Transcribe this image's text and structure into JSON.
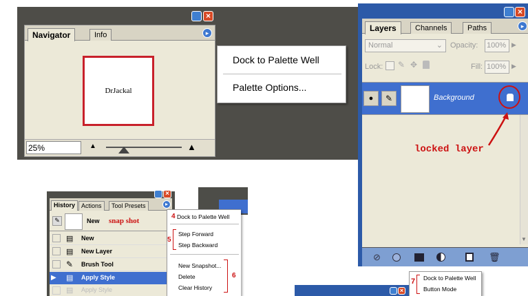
{
  "navigator": {
    "tabs": [
      "Navigator",
      "Info"
    ],
    "preview_text": "DrJackal",
    "zoom": "25%",
    "menu": [
      "Dock to Palette Well",
      "Palette Options..."
    ]
  },
  "layers": {
    "tabs": [
      "Layers",
      "Channels",
      "Paths"
    ],
    "blend_mode": "Normal",
    "opacity_label": "Opacity:",
    "opacity_value": "100%",
    "lock_label": "Lock:",
    "fill_label": "Fill:",
    "fill_value": "100%",
    "layer_name": "Background",
    "annotation": "locked layer"
  },
  "history": {
    "tabs": [
      "History",
      "Actions",
      "Tool Presets"
    ],
    "snapshot_name": "New",
    "snapshot_annotation": "snap shot",
    "items": [
      "New",
      "New Layer",
      "Brush Tool",
      "Apply Style",
      "Apply Style"
    ],
    "menu": {
      "dock": "Dock to Palette Well",
      "step_forward": "Step Forward",
      "step_backward": "Step Backward",
      "new_snapshot": "New Snapshot...",
      "delete": "Delete",
      "clear_history": "Clear History"
    },
    "markers": {
      "m4": "4",
      "m5": "5",
      "m6": "6"
    }
  },
  "bottom_menu": {
    "marker": "7",
    "items": [
      "Dock to Palette Well",
      "Button Mode"
    ]
  },
  "colors": {
    "accent": "#3f6fcf",
    "annotation_red": "#cc1111",
    "panel_bg": "#ece9d8"
  }
}
